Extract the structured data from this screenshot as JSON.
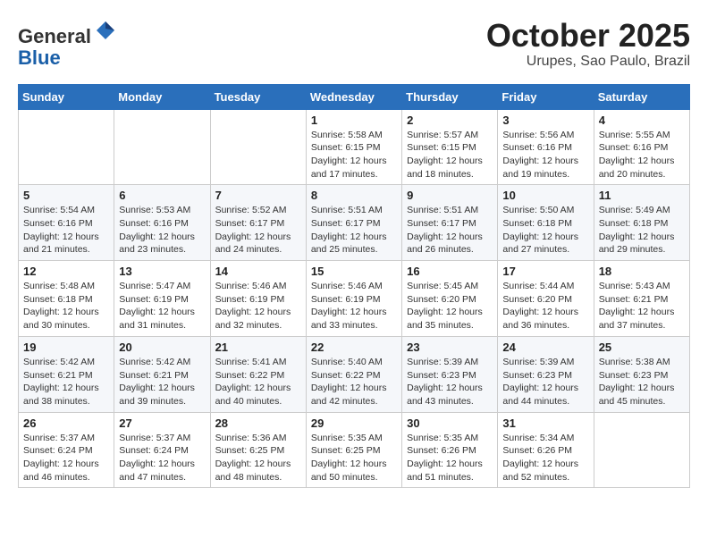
{
  "header": {
    "logo_line1": "General",
    "logo_line2": "Blue",
    "month": "October 2025",
    "location": "Urupes, Sao Paulo, Brazil"
  },
  "weekdays": [
    "Sunday",
    "Monday",
    "Tuesday",
    "Wednesday",
    "Thursday",
    "Friday",
    "Saturday"
  ],
  "weeks": [
    [
      {
        "day": "",
        "info": ""
      },
      {
        "day": "",
        "info": ""
      },
      {
        "day": "",
        "info": ""
      },
      {
        "day": "1",
        "info": "Sunrise: 5:58 AM\nSunset: 6:15 PM\nDaylight: 12 hours and 17 minutes."
      },
      {
        "day": "2",
        "info": "Sunrise: 5:57 AM\nSunset: 6:15 PM\nDaylight: 12 hours and 18 minutes."
      },
      {
        "day": "3",
        "info": "Sunrise: 5:56 AM\nSunset: 6:16 PM\nDaylight: 12 hours and 19 minutes."
      },
      {
        "day": "4",
        "info": "Sunrise: 5:55 AM\nSunset: 6:16 PM\nDaylight: 12 hours and 20 minutes."
      }
    ],
    [
      {
        "day": "5",
        "info": "Sunrise: 5:54 AM\nSunset: 6:16 PM\nDaylight: 12 hours and 21 minutes."
      },
      {
        "day": "6",
        "info": "Sunrise: 5:53 AM\nSunset: 6:16 PM\nDaylight: 12 hours and 23 minutes."
      },
      {
        "day": "7",
        "info": "Sunrise: 5:52 AM\nSunset: 6:17 PM\nDaylight: 12 hours and 24 minutes."
      },
      {
        "day": "8",
        "info": "Sunrise: 5:51 AM\nSunset: 6:17 PM\nDaylight: 12 hours and 25 minutes."
      },
      {
        "day": "9",
        "info": "Sunrise: 5:51 AM\nSunset: 6:17 PM\nDaylight: 12 hours and 26 minutes."
      },
      {
        "day": "10",
        "info": "Sunrise: 5:50 AM\nSunset: 6:18 PM\nDaylight: 12 hours and 27 minutes."
      },
      {
        "day": "11",
        "info": "Sunrise: 5:49 AM\nSunset: 6:18 PM\nDaylight: 12 hours and 29 minutes."
      }
    ],
    [
      {
        "day": "12",
        "info": "Sunrise: 5:48 AM\nSunset: 6:18 PM\nDaylight: 12 hours and 30 minutes."
      },
      {
        "day": "13",
        "info": "Sunrise: 5:47 AM\nSunset: 6:19 PM\nDaylight: 12 hours and 31 minutes."
      },
      {
        "day": "14",
        "info": "Sunrise: 5:46 AM\nSunset: 6:19 PM\nDaylight: 12 hours and 32 minutes."
      },
      {
        "day": "15",
        "info": "Sunrise: 5:46 AM\nSunset: 6:19 PM\nDaylight: 12 hours and 33 minutes."
      },
      {
        "day": "16",
        "info": "Sunrise: 5:45 AM\nSunset: 6:20 PM\nDaylight: 12 hours and 35 minutes."
      },
      {
        "day": "17",
        "info": "Sunrise: 5:44 AM\nSunset: 6:20 PM\nDaylight: 12 hours and 36 minutes."
      },
      {
        "day": "18",
        "info": "Sunrise: 5:43 AM\nSunset: 6:21 PM\nDaylight: 12 hours and 37 minutes."
      }
    ],
    [
      {
        "day": "19",
        "info": "Sunrise: 5:42 AM\nSunset: 6:21 PM\nDaylight: 12 hours and 38 minutes."
      },
      {
        "day": "20",
        "info": "Sunrise: 5:42 AM\nSunset: 6:21 PM\nDaylight: 12 hours and 39 minutes."
      },
      {
        "day": "21",
        "info": "Sunrise: 5:41 AM\nSunset: 6:22 PM\nDaylight: 12 hours and 40 minutes."
      },
      {
        "day": "22",
        "info": "Sunrise: 5:40 AM\nSunset: 6:22 PM\nDaylight: 12 hours and 42 minutes."
      },
      {
        "day": "23",
        "info": "Sunrise: 5:39 AM\nSunset: 6:23 PM\nDaylight: 12 hours and 43 minutes."
      },
      {
        "day": "24",
        "info": "Sunrise: 5:39 AM\nSunset: 6:23 PM\nDaylight: 12 hours and 44 minutes."
      },
      {
        "day": "25",
        "info": "Sunrise: 5:38 AM\nSunset: 6:23 PM\nDaylight: 12 hours and 45 minutes."
      }
    ],
    [
      {
        "day": "26",
        "info": "Sunrise: 5:37 AM\nSunset: 6:24 PM\nDaylight: 12 hours and 46 minutes."
      },
      {
        "day": "27",
        "info": "Sunrise: 5:37 AM\nSunset: 6:24 PM\nDaylight: 12 hours and 47 minutes."
      },
      {
        "day": "28",
        "info": "Sunrise: 5:36 AM\nSunset: 6:25 PM\nDaylight: 12 hours and 48 minutes."
      },
      {
        "day": "29",
        "info": "Sunrise: 5:35 AM\nSunset: 6:25 PM\nDaylight: 12 hours and 50 minutes."
      },
      {
        "day": "30",
        "info": "Sunrise: 5:35 AM\nSunset: 6:26 PM\nDaylight: 12 hours and 51 minutes."
      },
      {
        "day": "31",
        "info": "Sunrise: 5:34 AM\nSunset: 6:26 PM\nDaylight: 12 hours and 52 minutes."
      },
      {
        "day": "",
        "info": ""
      }
    ]
  ]
}
